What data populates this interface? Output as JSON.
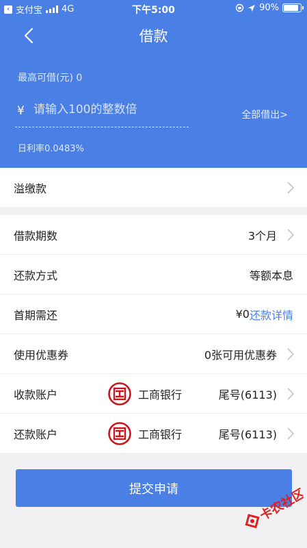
{
  "status_bar": {
    "back_app": "支付宝",
    "network": "4G",
    "time": "下午5:00",
    "battery": "90%"
  },
  "nav": {
    "title": "借款"
  },
  "loan_input": {
    "max_label": "最高可借(元)  0",
    "currency": "¥",
    "placeholder": "请输入100的整数倍",
    "borrow_all": "全部借出>",
    "daily_rate": "日利率0.0483%"
  },
  "overpayment": {
    "label": "溢缴款"
  },
  "details": {
    "term": {
      "label": "借款期数",
      "value": "3个月"
    },
    "method": {
      "label": "还款方式",
      "value": "等额本息"
    },
    "first_payment": {
      "label": "首期需还",
      "value": "¥0",
      "link": "还款详情"
    },
    "coupon": {
      "label": "使用优惠券",
      "value": "0张可用优惠券"
    },
    "receive_account": {
      "label": "收款账户",
      "bank": "工商银行",
      "tail": "尾号(6113)"
    },
    "repay_account": {
      "label": "还款账户",
      "bank": "工商银行",
      "tail": "尾号(6113)"
    }
  },
  "submit_label": "提交申请",
  "watermark_text": "卡农社区",
  "colors": {
    "primary": "#4a7fe5",
    "bank_red": "#c8161d",
    "watermark_red": "#e02020"
  },
  "icons": {
    "bank_logo": "icbc-logo-icon",
    "row_arrow": "chevron-right-icon",
    "back": "chevron-left-icon"
  }
}
